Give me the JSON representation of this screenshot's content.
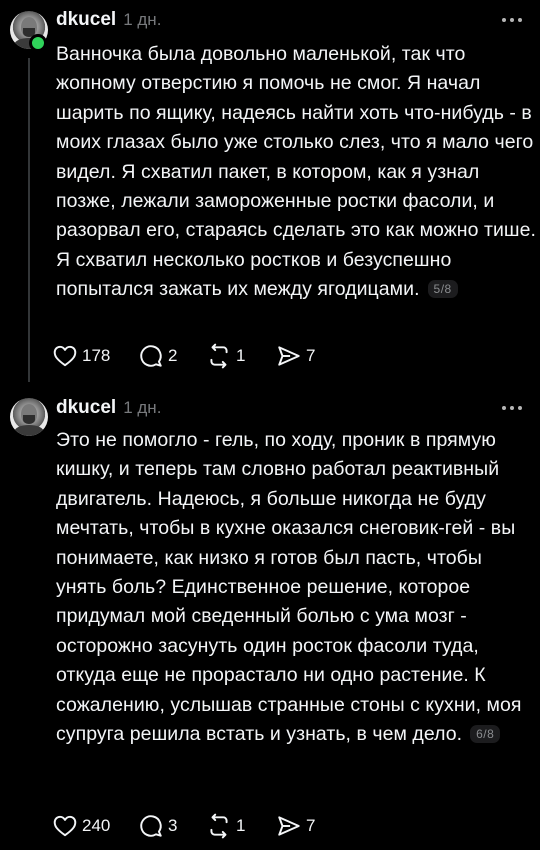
{
  "posts": [
    {
      "username": "dkucel",
      "time": "1 дн.",
      "text": "Ванночка была довольно маленькой, так что жопному отверстию я помочь не смог. Я начал шарить по ящику, надеясь найти хоть что-нибудь - в моих глазах было уже столько слез, что я мало чего видел. Я схватил пакет, в котором, как я узнал позже, лежали замороженные ростки фасоли, и разорвал его, стараясь сделать это как можно тише. Я схватил несколько ростков и безуспешно попытался зажать их между ягодицами.",
      "page_badge": "5/8",
      "likes": "178",
      "comments": "2",
      "reposts": "1",
      "shares": "7",
      "online": true
    },
    {
      "username": "dkucel",
      "time": "1 дн.",
      "text": "Это не помогло - гель, по ходу, проник в прямую кишку, и теперь там словно работал реактивный двигатель. Надеюсь, я больше никогда не буду мечтать, чтобы в кухне оказался снеговик-гей - вы понимаете, как низко я готов был пасть, чтобы унять боль? Единственное решение, которое придумал мой сведенный болью с ума мозг - осторожно засунуть один росток фасоли туда, откуда еще не прорастало ни одно растение. К сожалению, услышав странные стоны с кухни, моя супруга решила встать и узнать, в чем дело.",
      "page_badge": "6/8",
      "likes": "240",
      "comments": "3",
      "reposts": "1",
      "shares": "7",
      "online": false
    }
  ],
  "colors": {
    "background": "#000000",
    "text": "#f3f5f7",
    "muted": "#77797c",
    "online": "#2fd35a"
  },
  "icons": [
    "heart-icon",
    "comment-icon",
    "repost-icon",
    "share-icon",
    "more-icon"
  ]
}
